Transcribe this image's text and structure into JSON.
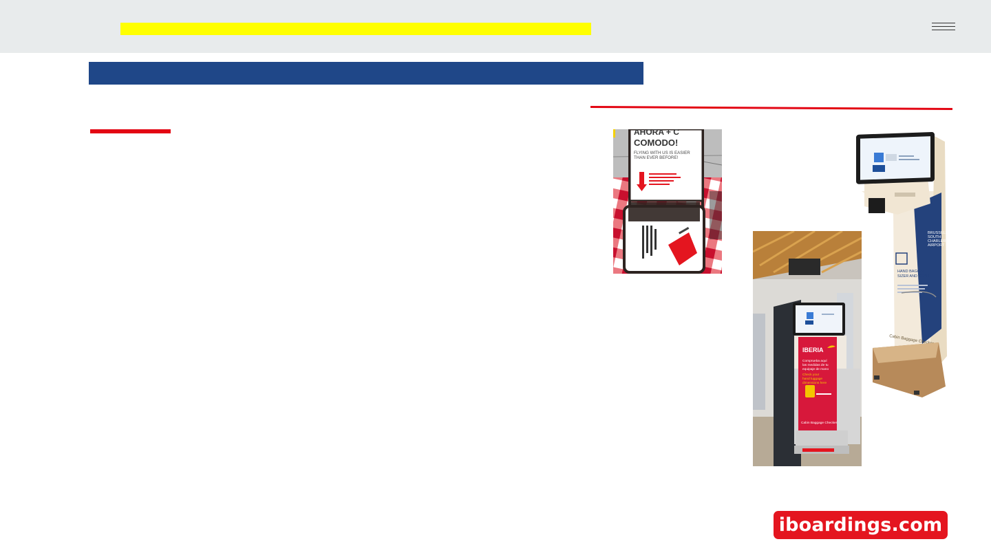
{
  "brand": {
    "label": "iboardings.com",
    "background": "#e4151f",
    "text_color": "#ffffff"
  },
  "header": {
    "background": "#e8ebec",
    "highlight_color": "#ffff00",
    "menu_icon": "hamburger-menu-icon"
  },
  "banner": {
    "color": "#1f4788"
  },
  "accent": {
    "red": "#e30613"
  },
  "photos": {
    "sign": {
      "headline_1": "AHORA + C",
      "headline_2": "COMODO!",
      "subline_1": "FLYING WITH US IS EASIER",
      "subline_2": "THAN EVER BEFORE!"
    },
    "kiosk": {
      "brand": "IBERIA",
      "text_es_1": "Comprueba aquí",
      "text_es_2": "las medidas de tu",
      "text_es_3": "equipaje de mano",
      "text_en_1": "Check your",
      "text_en_2": "hand luggage",
      "text_en_3": "dimensions here",
      "base": "Cabin Baggage Checker"
    },
    "scale": {
      "airport_1": "BRUSSELS",
      "airport_2": "SOUTH",
      "airport_3": "CHARLEROI",
      "airport_4": "AIRPORT",
      "title_1": "HAND BAGGAGE",
      "title_2": "SIZER AND SCALE",
      "base": "Cabin Baggage Checker"
    }
  }
}
